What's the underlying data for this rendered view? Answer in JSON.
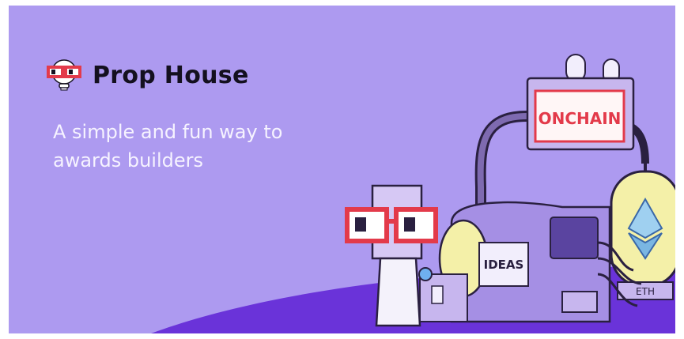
{
  "brand": {
    "name": "Prop House",
    "logo_icon": "glasses-head-icon"
  },
  "hero": {
    "tagline": "A simple and fun way to awards builders"
  },
  "illustration": {
    "robot_icon": "robot-with-glasses-icon",
    "machine_icon": "idea-machine-icon",
    "onchain_sign": "ONCHAIN",
    "ideas_label": "IDEAS",
    "eth_label": "ETH",
    "eth_icon": "ethereum-diamond-icon"
  },
  "colors": {
    "background": "#ad9af0",
    "ground": "#6a33d9",
    "accent_red": "#e33a4a",
    "brand_text": "#14101f",
    "tagline_text": "#f6f3ff"
  }
}
